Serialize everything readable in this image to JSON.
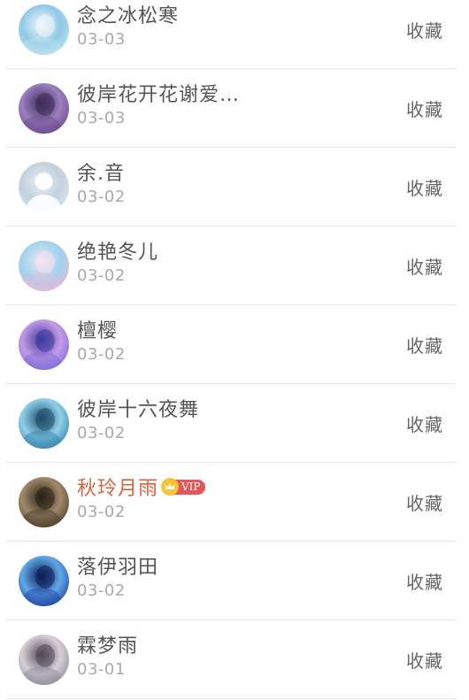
{
  "collect_label": "收藏",
  "vip_badge_label": "VIP",
  "items": [
    {
      "name": "念之冰松寒",
      "date": "03-03",
      "vip": false,
      "avatar_colors": [
        "#bfe3f0",
        "#8fc9e6",
        "#f3f7fb"
      ]
    },
    {
      "name": "彼岸花开花谢爱…",
      "date": "03-03",
      "vip": false,
      "avatar_colors": [
        "#6a4a8c",
        "#9c7fc0",
        "#3a2a55"
      ]
    },
    {
      "name": "余.音",
      "date": "03-02",
      "vip": false,
      "avatar_colors": [
        "#dde6ef",
        "#c3d0de",
        "#e9eef4"
      ]
    },
    {
      "name": "绝艳冬儿",
      "date": "03-02",
      "vip": false,
      "avatar_colors": [
        "#e8b8d6",
        "#9fd3ee",
        "#f6e3ef"
      ]
    },
    {
      "name": "檀樱",
      "date": "03-02",
      "vip": false,
      "avatar_colors": [
        "#7b6bd6",
        "#c49be8",
        "#3d3a9a"
      ]
    },
    {
      "name": "彼岸十六夜舞",
      "date": "03-02",
      "vip": false,
      "avatar_colors": [
        "#2f7fa8",
        "#8fd0e8",
        "#1d4c6a"
      ]
    },
    {
      "name": "秋玲月雨",
      "date": "03-02",
      "vip": true,
      "avatar_colors": [
        "#4a3a2a",
        "#a08a6a",
        "#2a2018"
      ]
    },
    {
      "name": "落伊羽田",
      "date": "03-02",
      "vip": false,
      "avatar_colors": [
        "#1f3fa0",
        "#5fa8e8",
        "#0c1c55"
      ]
    },
    {
      "name": "霖梦雨",
      "date": "03-01",
      "vip": false,
      "avatar_colors": [
        "#8a8a9a",
        "#d8cfd6",
        "#4f4a55"
      ]
    }
  ]
}
